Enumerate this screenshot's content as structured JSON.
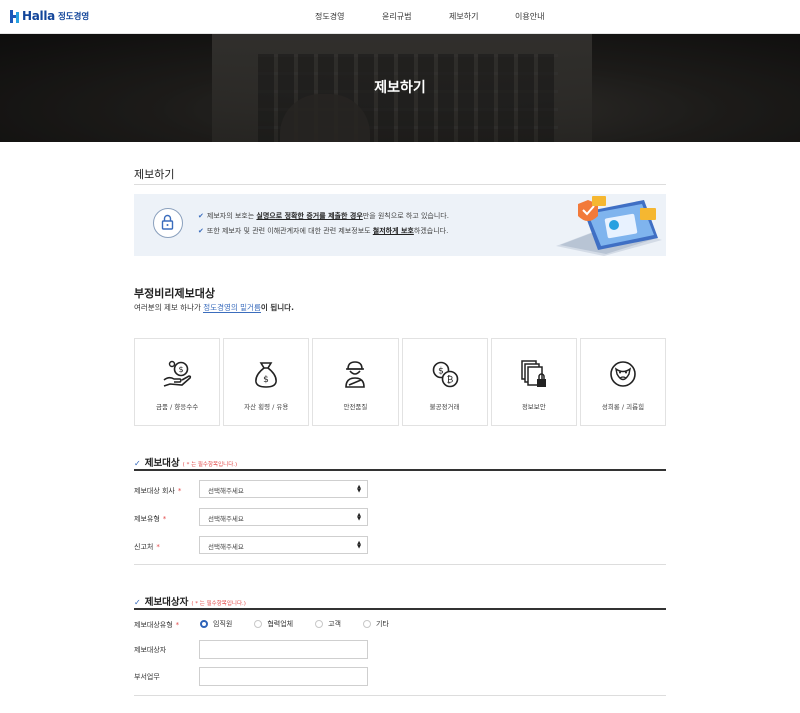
{
  "header": {
    "logo_text": "Halla",
    "logo_sub": "정도경영",
    "nav": [
      "정도경영",
      "윤리규범",
      "제보하기",
      "이용안내"
    ]
  },
  "hero": {
    "title": "제보하기"
  },
  "section": {
    "title": "제보하기"
  },
  "notice": {
    "line1": {
      "pre": "제보자의 보호는 ",
      "bold": "실명으로 정확한 증거를 제출한 경우",
      "post": "만을 원칙으로 하고 있습니다."
    },
    "line2": {
      "pre": "또한 제보자 및 관련 이해관계자에 대한 관련 제보정보도 ",
      "bold": "철저하게 보호",
      "post": "하겠습니다."
    }
  },
  "targets": {
    "title": "부정비리제보대상",
    "subtitle_pre": "여러분의 제보 하나가 ",
    "subtitle_link": "정도경영의 밑거름",
    "subtitle_post": "이 됩니다.",
    "categories": [
      {
        "label": "금품 / 향응수수",
        "icon": "money-hand-icon"
      },
      {
        "label": "자산 횡령 / 유용",
        "icon": "money-bag-icon"
      },
      {
        "label": "안전품질",
        "icon": "safety-worker-icon"
      },
      {
        "label": "불공정거래",
        "icon": "coins-exchange-icon"
      },
      {
        "label": "정보보안",
        "icon": "document-lock-icon"
      },
      {
        "label": "성희롱 / 괴롭힘",
        "icon": "angry-face-icon"
      }
    ]
  },
  "form1": {
    "title": "제보대상",
    "required_note": "( * 는 필수항목입니다.)",
    "fields": [
      {
        "label": "제보대상 회사",
        "required": "*",
        "value": "선택해주세요"
      },
      {
        "label": "제보유형",
        "required": "*",
        "value": "선택해주세요"
      },
      {
        "label": "신고처",
        "required": "*",
        "value": "선택해주세요"
      }
    ]
  },
  "form2": {
    "title": "제보대상자",
    "required_note": "( * 는 필수항목입니다.)",
    "type_label": "제보대상유형",
    "type_required": "*",
    "options": [
      "임직원",
      "협력업체",
      "고객",
      "기타"
    ],
    "selected": "임직원",
    "name_label": "제보대상자",
    "dept_label": "부서업무"
  },
  "colors": {
    "accent": "#2e63b8",
    "required": "#e24a4a",
    "notice_bg": "#edf2f8"
  }
}
